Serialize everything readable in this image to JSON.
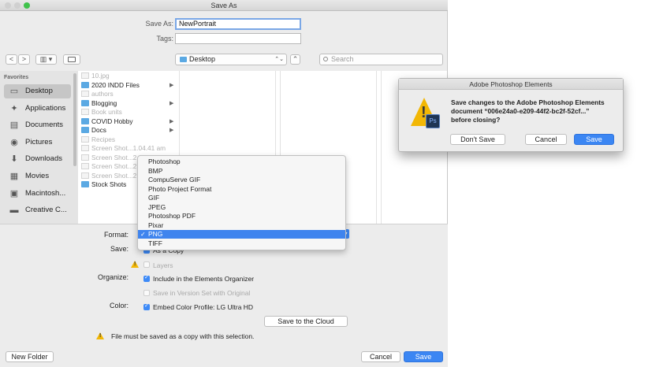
{
  "window": {
    "title": "Save As"
  },
  "name_row": {
    "label": "Save As:",
    "value": "NewPortrait"
  },
  "tags_row": {
    "label": "Tags:",
    "value": ""
  },
  "toolbar": {
    "back_glyph": "<",
    "forward_glyph": ">",
    "view_glyph": "▥ ▾",
    "location": "Desktop",
    "location_arrows": "⌃⌄",
    "expand_glyph": "⌃",
    "search_placeholder": "Search"
  },
  "sidebar": {
    "heading": "Favorites",
    "items": [
      {
        "label": "Desktop",
        "icon": "desktop-icon",
        "glyph": "▭"
      },
      {
        "label": "Applications",
        "icon": "applications-icon",
        "glyph": "✦"
      },
      {
        "label": "Documents",
        "icon": "documents-icon",
        "glyph": "▤"
      },
      {
        "label": "Pictures",
        "icon": "pictures-icon",
        "glyph": "◉"
      },
      {
        "label": "Downloads",
        "icon": "downloads-icon",
        "glyph": "⬇"
      },
      {
        "label": "Movies",
        "icon": "movies-icon",
        "glyph": "▦"
      },
      {
        "label": "Macintosh...",
        "icon": "disk-icon",
        "glyph": "▣"
      },
      {
        "label": "Creative C...",
        "icon": "folder-icon",
        "glyph": "▬"
      }
    ]
  },
  "files": [
    {
      "name": "10.jpg",
      "type": "doc",
      "dim": true
    },
    {
      "name": "2020 INDD Files",
      "type": "folder",
      "dim": false,
      "arrow": "▶"
    },
    {
      "name": "authors",
      "type": "doc",
      "dim": true
    },
    {
      "name": "Blogging",
      "type": "folder",
      "dim": false,
      "arrow": "▶"
    },
    {
      "name": "Book units",
      "type": "doc",
      "dim": true
    },
    {
      "name": "COVID Hobby",
      "type": "folder",
      "dim": false,
      "arrow": "▶"
    },
    {
      "name": "Docs",
      "type": "folder",
      "dim": false,
      "arrow": "▶"
    },
    {
      "name": "Recipes",
      "type": "doc",
      "dim": true
    },
    {
      "name": "Screen Shot...1.04.41 am",
      "type": "doc",
      "dim": true
    },
    {
      "name": "Screen Shot...2.03.34 pm",
      "type": "doc",
      "dim": true
    },
    {
      "name": "Screen Shot...2.",
      "type": "doc",
      "dim": true
    },
    {
      "name": "Screen Shot...2.",
      "type": "doc",
      "dim": true
    },
    {
      "name": "Stock Shots",
      "type": "folder",
      "dim": false
    }
  ],
  "format": {
    "label": "Format:",
    "selected": "PNG",
    "arrow_glyph": "▴▾",
    "options": [
      "Photoshop",
      "BMP",
      "CompuServe GIF",
      "Photo Project Format",
      "GIF",
      "JPEG",
      "Photoshop PDF",
      "Pixar",
      "PNG",
      "TIFF"
    ],
    "check_glyph": "✓"
  },
  "save_opts": {
    "label": "Save:",
    "as_copy": "As a Copy",
    "layers": "Layers"
  },
  "organize": {
    "label": "Organize:",
    "include": "Include in the Elements Organizer",
    "version_set": "Save in Version Set with Original"
  },
  "color": {
    "label": "Color:",
    "embed": "Embed Color Profile:  LG Ultra HD"
  },
  "cloud_button": "Save to the Cloud",
  "warning_text": "File must be saved as a copy with this selection.",
  "footer": {
    "new_folder": "New Folder",
    "cancel": "Cancel",
    "save": "Save"
  },
  "alert": {
    "title": "Adobe Photoshop Elements",
    "line1": "Save changes to the Adobe Photoshop Elements",
    "line2": "document “006e24a0-e209-44f2-bc2f-52cf...”",
    "line3": "before closing?",
    "badge": "Ps",
    "dont_save": "Don't Save",
    "cancel": "Cancel",
    "save": "Save"
  },
  "colors": {
    "accent": "#3b86f3",
    "folder": "#5ba9e3",
    "warning": "#f2b705"
  }
}
